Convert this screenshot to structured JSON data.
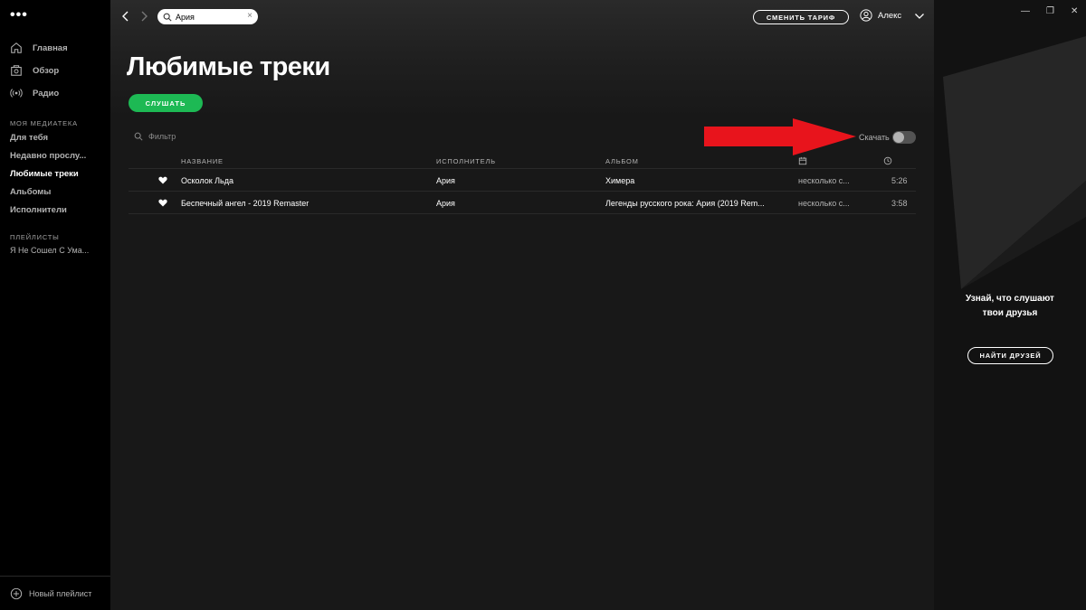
{
  "app": {
    "menu_dots": "•••"
  },
  "sidebar": {
    "nav": [
      {
        "label": "Главная",
        "icon": "home-icon"
      },
      {
        "label": "Обзор",
        "icon": "browse-icon"
      },
      {
        "label": "Радио",
        "icon": "radio-icon"
      }
    ],
    "library_title": "МОЯ МЕДИАТЕКА",
    "library": [
      {
        "label": "Для тебя"
      },
      {
        "label": "Недавно прослу..."
      },
      {
        "label": "Любимые треки",
        "active": true
      },
      {
        "label": "Альбомы"
      },
      {
        "label": "Исполнители"
      }
    ],
    "playlists_title": "ПЛЕЙЛИСТЫ",
    "playlists": [
      {
        "label": "Я Не Сошел С Ума..."
      }
    ],
    "new_playlist": "Новый плейлист"
  },
  "topbar": {
    "search_value": "Ария",
    "search_clear": "×",
    "upgrade_label": "СМЕНИТЬ ТАРИФ",
    "user_name": "Алекс"
  },
  "page": {
    "title": "Любимые треки",
    "play_label": "СЛУШАТЬ",
    "filter_placeholder": "Фильтр",
    "download_label": "Скачать",
    "download_enabled": false
  },
  "table": {
    "headers": {
      "title": "НАЗВАНИЕ",
      "artist": "ИСПОЛНИТЕЛЬ",
      "album": "АЛЬБОМ"
    },
    "rows": [
      {
        "title": "Осколок Льда",
        "artist": "Ария",
        "album": "Химера",
        "added": "несколько с...",
        "duration": "5:26"
      },
      {
        "title": "Беспечный ангел - 2019 Remaster",
        "artist": "Ария",
        "album": "Легенды русского рока: Ария (2019 Rem...",
        "added": "несколько с...",
        "duration": "3:58"
      }
    ]
  },
  "friends": {
    "text_line1": "Узнай, что слушают",
    "text_line2": "твои друзья",
    "find_label": "НАЙТИ ДРУЗЕЙ",
    "win_minimize": "—",
    "win_restore": "❐",
    "win_close": "✕"
  },
  "colors": {
    "accent": "#1db954",
    "annotation_arrow": "#e8141c"
  }
}
